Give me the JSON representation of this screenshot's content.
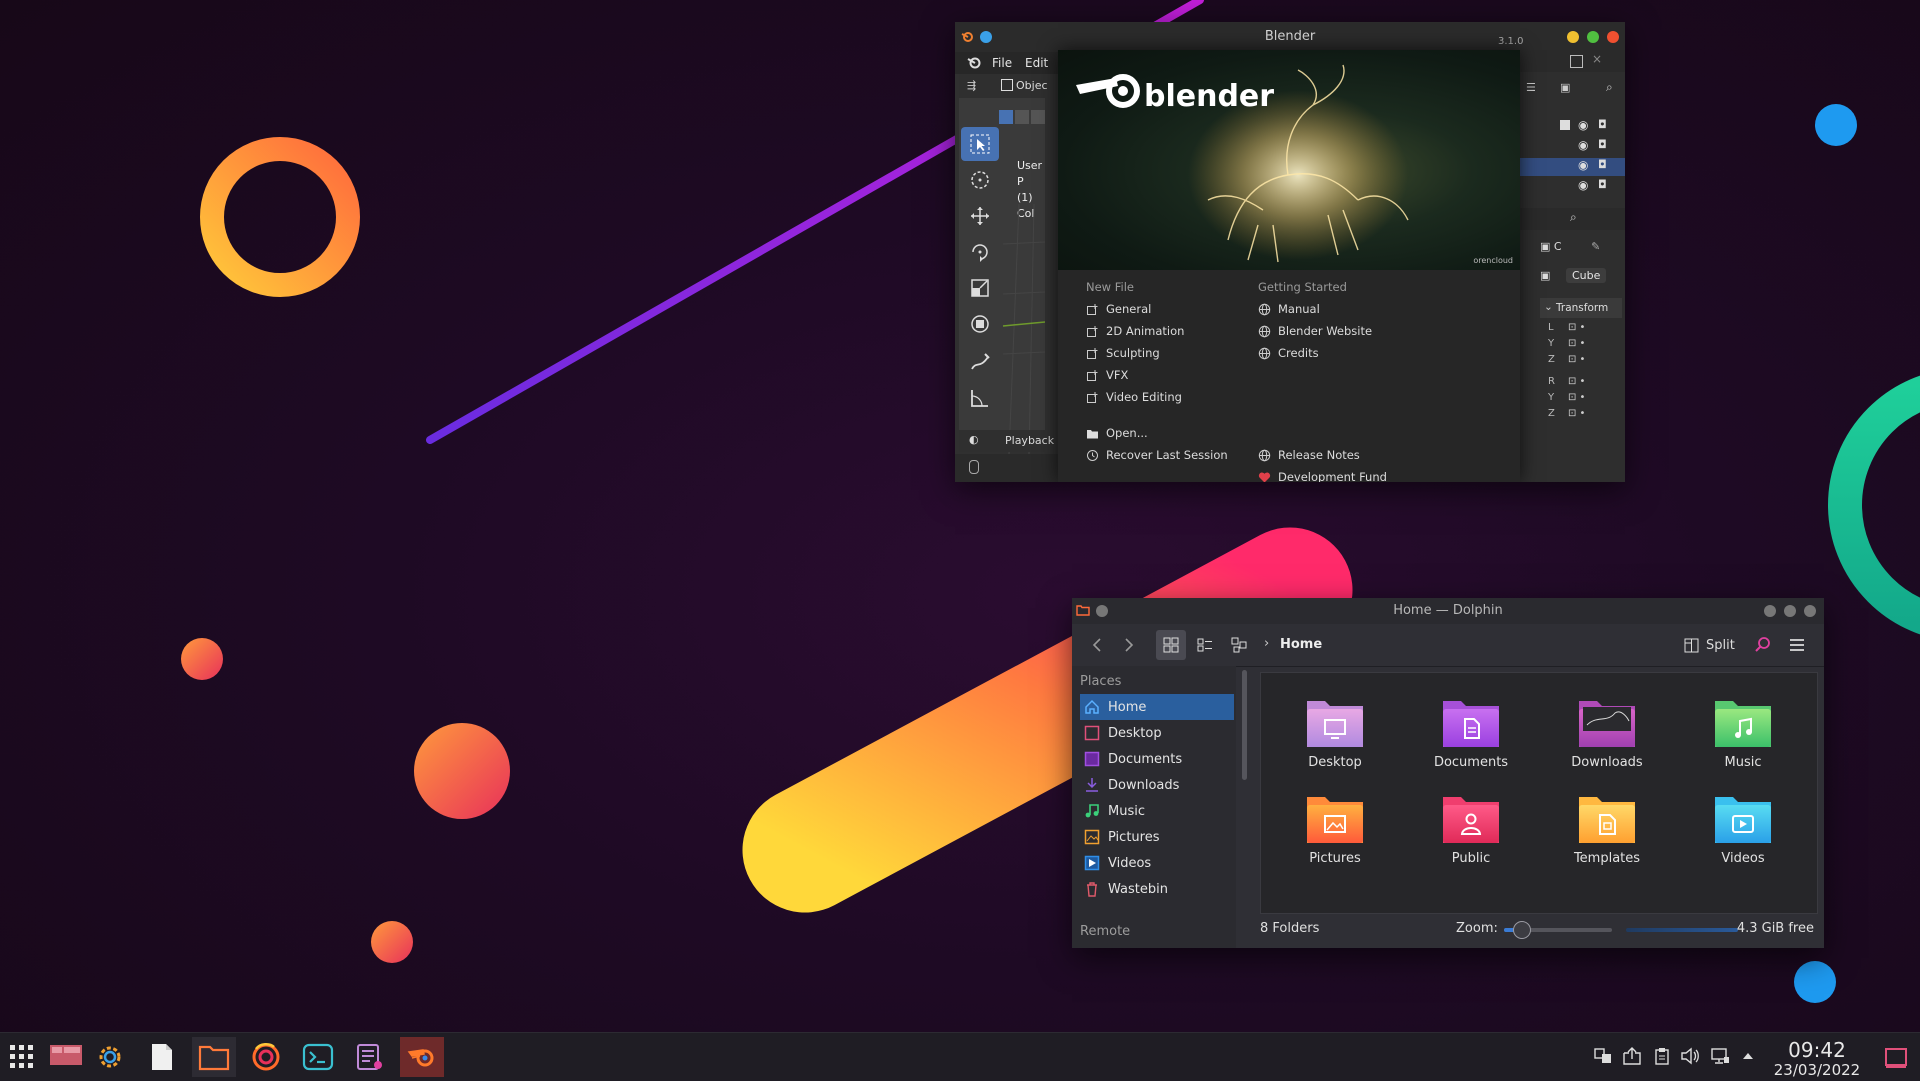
{
  "blender": {
    "title": "Blender",
    "menu": {
      "file": "File",
      "edit": "Edit"
    },
    "header_mode": "Objec",
    "viewport_info": {
      "line1": "User P",
      "line2": "(1) Col"
    },
    "playback": "Playback",
    "version": "3.1.0",
    "splash": {
      "logo_text": "blender",
      "credit": "orencloud",
      "new_file_heading": "New File",
      "new_file_items": [
        "General",
        "2D Animation",
        "Sculpting",
        "VFX",
        "Video Editing"
      ],
      "open": "Open...",
      "recover": "Recover Last Session",
      "getting_started_heading": "Getting Started",
      "getting_started_items": [
        "Manual",
        "Blender Website",
        "Credits"
      ],
      "release_notes": "Release Notes",
      "development_fund": "Development Fund"
    },
    "properties": {
      "object_name": "Cube",
      "object_short": "C",
      "transform": "Transform",
      "axes": [
        "L",
        "Y",
        "Z",
        "R",
        "Y",
        "Z"
      ]
    }
  },
  "dolphin": {
    "title": "Home — Dolphin",
    "breadcrumb": "Home",
    "split_label": "Split",
    "places_heading": "Places",
    "remote_heading": "Remote",
    "places": [
      {
        "label": "Home",
        "icon": "home-icon",
        "color": "#3aa0ff"
      },
      {
        "label": "Desktop",
        "icon": "desktop-icon",
        "color": "#e0507a"
      },
      {
        "label": "Documents",
        "icon": "documents-icon",
        "color": "#a04fe0"
      },
      {
        "label": "Downloads",
        "icon": "downloads-icon",
        "color": "#8a5de0"
      },
      {
        "label": "Music",
        "icon": "music-icon",
        "color": "#3bd07a"
      },
      {
        "label": "Pictures",
        "icon": "pictures-icon",
        "color": "#f0a030"
      },
      {
        "label": "Videos",
        "icon": "videos-icon",
        "color": "#2f8ee8"
      },
      {
        "label": "Wastebin",
        "icon": "wastebin-icon",
        "color": "#e05a6a"
      }
    ],
    "folders": [
      {
        "label": "Desktop",
        "top": "#e6a0e0",
        "bottom": "#b48be0"
      },
      {
        "label": "Documents",
        "top": "#c76bf0",
        "bottom": "#9a3fe0"
      },
      {
        "label": "Downloads",
        "top": "#d05fc0",
        "bottom": "#a03fb0"
      },
      {
        "label": "Music",
        "top": "#8ee07a",
        "bottom": "#3bc06a"
      },
      {
        "label": "Pictures",
        "top": "#ffb040",
        "bottom": "#ff6a3a"
      },
      {
        "label": "Public",
        "top": "#ff5080",
        "bottom": "#e83060"
      },
      {
        "label": "Templates",
        "top": "#ffd060",
        "bottom": "#ffa030"
      },
      {
        "label": "Videos",
        "top": "#4fd8f0",
        "bottom": "#2aa8e8"
      }
    ],
    "status": {
      "count": "8 Folders",
      "zoom_label": "Zoom:",
      "zoom_level": 0.1,
      "free_space": "4.3 GiB free"
    }
  },
  "taskbar": {
    "time": "09:42",
    "date": "23/03/2022",
    "apps": [
      "app-launcher-icon",
      "desktop-pager-icon",
      "system-settings-icon",
      "text-file-icon",
      "file-manager-icon",
      "firefox-icon",
      "terminal-icon",
      "text-editor-icon",
      "blender-icon"
    ]
  },
  "colors": {
    "accent_blue": "#3a7bd5",
    "selection": "#2a5f9e",
    "blender_active_tool": "#4772b3",
    "taskbar_active": "#6e2a2a"
  }
}
